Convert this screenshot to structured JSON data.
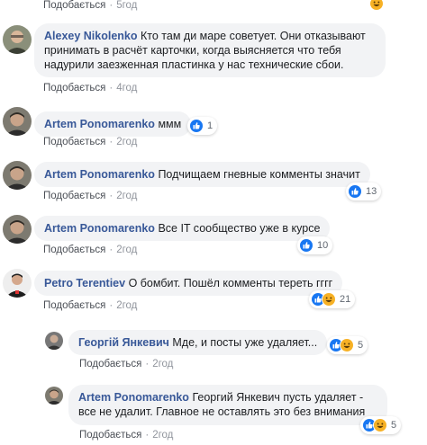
{
  "like_label": "Подобається",
  "dot": "·",
  "top": {
    "time": "5год"
  },
  "comments": [
    {
      "author": "Alexey Nikolenko",
      "text": "Кто там ди маре советует. Они отказывают принимать в расчёт карточки, когда выясняется что тебя надурили заезженная пластинка у нас технические сбои.",
      "line1": "Кто там ди маре советует. Они отказывают",
      "line2": "принимать в расчёт карточки, когда выясняется что тебя",
      "line3": "надурили заезженная пластинка у нас технические сбои.",
      "time": "4год"
    },
    {
      "author": "Artem Ponomarenko",
      "text": "ммм",
      "time": "2год",
      "reactions": "1"
    },
    {
      "author": "Artem Ponomarenko",
      "text": "Подчищаем гневные комменты значит",
      "time": "2год",
      "reactions": "13"
    },
    {
      "author": "Artem Ponomarenko",
      "text": "Все IT сообщество уже в курсе",
      "time": "2год",
      "reactions": "10"
    },
    {
      "author": "Petro Terentiev",
      "text": "О бомбит. Пошёл комменты тереть гггг",
      "time": "2год",
      "reactions": "21"
    }
  ],
  "replies": [
    {
      "author": "Георгій Янкевич",
      "text": "Мде, и посты уже удаляет...",
      "time": "2год",
      "reactions": "5"
    },
    {
      "author": "Artem Ponomarenko",
      "line1": "Георгий Янкевич пусть удаляет -",
      "line2": "все не удалит. Главное не оставлять это без внимания",
      "time": "2год",
      "reactions": "5"
    }
  ],
  "colors": {
    "author": "#385898",
    "bubble": "#f2f3f5",
    "meta": "#90949c",
    "like_blue": "#1877f2",
    "haha_yellow": "#f7b125"
  },
  "icons": [
    "like-icon",
    "haha-icon"
  ]
}
